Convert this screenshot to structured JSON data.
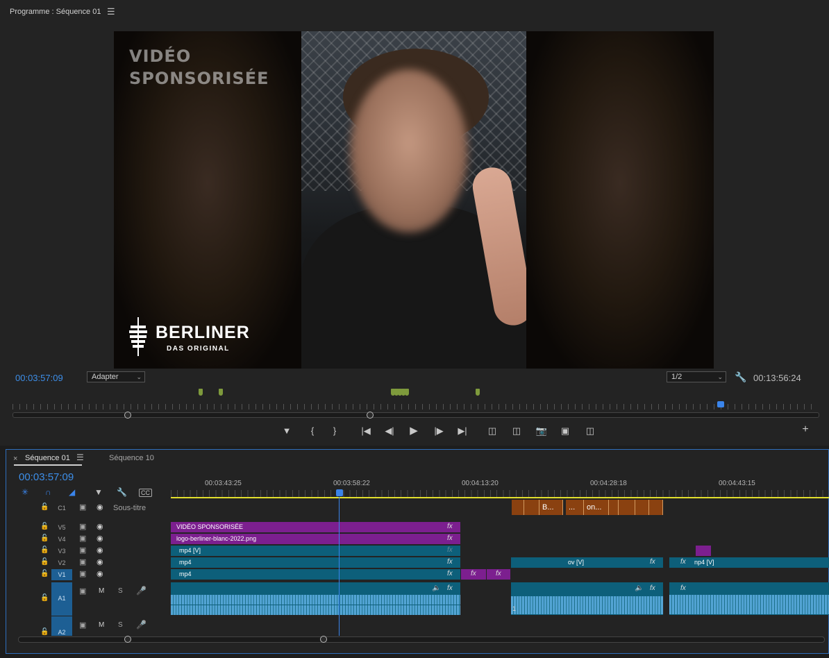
{
  "program": {
    "title": "Programme : Séquence 01",
    "menu_icon": "☰",
    "overlay_title": "VIDÉO\nSPONSORISÉE",
    "logo_main": "BERLINER",
    "logo_sub": "DAS ORIGINAL",
    "timecode": "00:03:57:09",
    "fit": "Adapter",
    "resolution": "1/2",
    "duration": "00:13:56:24"
  },
  "transport": {
    "icons": [
      "marker-icon",
      "mark-in-icon",
      "mark-out-icon",
      "go-to-in-icon",
      "step-back-icon",
      "play-icon",
      "step-forward-icon",
      "go-to-out-icon",
      "lift-icon",
      "extract-icon",
      "export-frame-icon",
      "comparison-view-icon",
      "proxy-toggle-icon",
      "add-button-icon"
    ]
  },
  "timeline": {
    "tab_active": "Séquence 01",
    "tab_other": "Séquence 10",
    "close": "×",
    "menu_icon": "☰",
    "timecode": "00:03:57:09",
    "ruler": [
      "00:03:43:25",
      "00:03:58:22",
      "00:04:13:20",
      "00:04:28:18",
      "00:04:43:15"
    ],
    "tracks": {
      "c1": "C1",
      "c1_label": "Sous-titre",
      "v5": "V5",
      "v4": "V4",
      "v3": "V3",
      "v2": "V2",
      "v1": "V1",
      "a1": "A1",
      "a2": "A2",
      "mute": "M",
      "solo": "S"
    },
    "clips": {
      "v5_clip": "VIDÉO SPONSORISÉE",
      "v4_clip": "logo-berliner-blanc-2022.png",
      "v3_clip": "mp4 [V]",
      "v2_clip_a": "mp4",
      "v2_clip_b": "ov [V]",
      "v2_clip_c": "np4 [V]",
      "v1_clip": "mp4",
      "cap_b": "B...",
      "cap_dots": "...",
      "cap_on": "on...",
      "fx": "fx",
      "audio_gain": "1"
    }
  },
  "colors": {
    "accent_blue": "#3d8ee8",
    "clip_purple": "#7c1f8f",
    "clip_teal": "#0d5f7a",
    "caption_orange": "#8a4110",
    "work_area_yellow": "#e2e02d"
  }
}
